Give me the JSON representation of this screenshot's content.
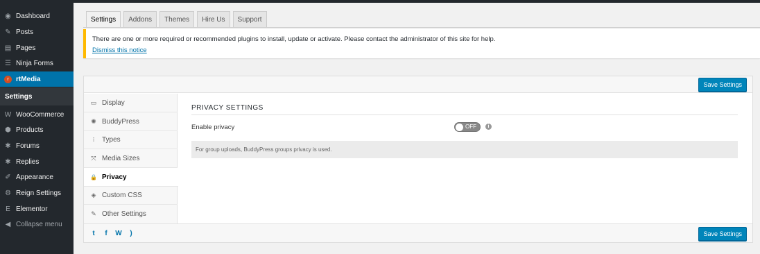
{
  "sidebar": {
    "items": [
      {
        "label": "Dashboard",
        "icon": "dashboard-icon",
        "glyph": "◉"
      },
      {
        "label": "Posts",
        "icon": "pin-icon",
        "glyph": "✎"
      },
      {
        "label": "Pages",
        "icon": "pages-icon",
        "glyph": "▤"
      },
      {
        "label": "Ninja Forms",
        "icon": "forms-icon",
        "glyph": "☰"
      },
      {
        "label": "rtMedia",
        "icon": "rtmedia-icon",
        "glyph": "r"
      },
      {
        "label": "WooCommerce",
        "icon": "woocommerce-icon",
        "glyph": "W"
      },
      {
        "label": "Products",
        "icon": "products-icon",
        "glyph": "⬢"
      },
      {
        "label": "Forums",
        "icon": "forums-icon",
        "glyph": "✱"
      },
      {
        "label": "Replies",
        "icon": "replies-icon",
        "glyph": "✱"
      },
      {
        "label": "Appearance",
        "icon": "brush-icon",
        "glyph": "✐"
      },
      {
        "label": "Reign Settings",
        "icon": "gear-icon",
        "glyph": "⚙"
      },
      {
        "label": "Elementor",
        "icon": "elementor-icon",
        "glyph": "E"
      },
      {
        "label": "Collapse menu",
        "icon": "collapse-icon",
        "glyph": "◀"
      }
    ],
    "submenu_label": "Settings"
  },
  "tabs": [
    "Settings",
    "Addons",
    "Themes",
    "Hire Us",
    "Support"
  ],
  "notice": {
    "text": "There are one or more required or recommended plugins to install, update or activate. Please contact the administrator of this site for help.",
    "dismiss": "Dismiss this notice",
    "accent": "#ffb900"
  },
  "panel": {
    "save_label": "Save Settings",
    "nav": [
      {
        "label": "Display",
        "icon": "monitor-icon",
        "glyph": "▭"
      },
      {
        "label": "BuddyPress",
        "icon": "buddypress-icon",
        "glyph": "✺"
      },
      {
        "label": "Types",
        "icon": "types-icon",
        "glyph": "⁝"
      },
      {
        "label": "Media Sizes",
        "icon": "resize-icon",
        "glyph": "⤧"
      },
      {
        "label": "Privacy",
        "icon": "lock-icon",
        "glyph": "🔒"
      },
      {
        "label": "Custom CSS",
        "icon": "css-icon",
        "glyph": "◈"
      },
      {
        "label": "Other Settings",
        "icon": "wrench-icon",
        "glyph": "✎"
      }
    ],
    "section_title": "PRIVACY SETTINGS",
    "enable_privacy_label": "Enable privacy",
    "toggle_state": "OFF",
    "info_glyph": "i",
    "info_text": "For group uploads, BuddyPress groups privacy is used.",
    "social": [
      {
        "icon": "twitter-icon",
        "glyph": "t"
      },
      {
        "icon": "facebook-icon",
        "glyph": "f"
      },
      {
        "icon": "wordpress-icon",
        "glyph": "W"
      },
      {
        "icon": "rss-icon",
        "glyph": ")"
      }
    ]
  },
  "colors": {
    "primary": "#0073aa",
    "sidebar_bg": "#23282d",
    "button": "#0085ba"
  }
}
